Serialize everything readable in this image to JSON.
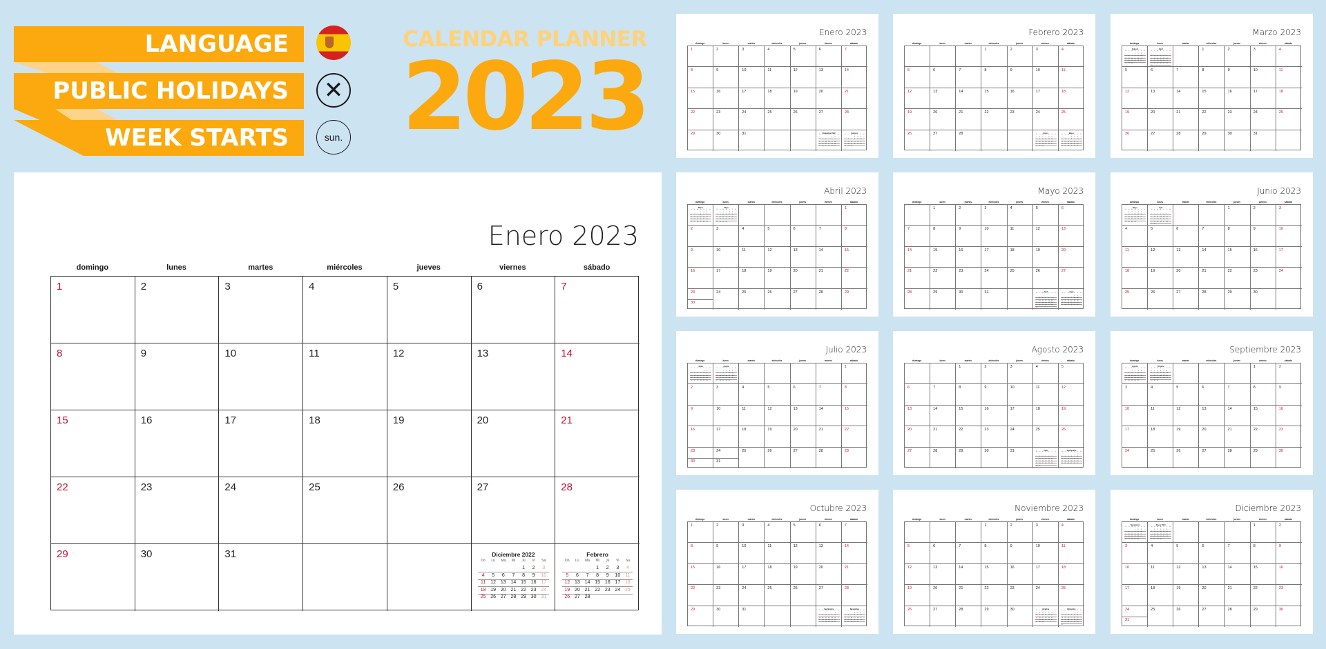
{
  "banner": {
    "language_label": "LANGUAGE",
    "holidays_label": "PUBLIC HOLIDAYS",
    "week_starts_label": "WEEK STARTS",
    "language_icon": "spain-flag-icon",
    "holidays_icon": "x-circle-icon",
    "holidays_symbol": "✕",
    "week_starts_value": "sun."
  },
  "header": {
    "subtitle": "CALENDAR PLANNER",
    "year": "2023"
  },
  "colors": {
    "background": "#cce3f2",
    "accent_orange": "#fba90e",
    "accent_light": "#fdd27a",
    "holiday_red": "#c8102e",
    "card": "#ffffff"
  },
  "weekdays_long": [
    "domingo",
    "lunes",
    "martes",
    "miércoles",
    "jueves",
    "viernes",
    "sábado"
  ],
  "weekdays_short": [
    "Do",
    "Lu",
    "Ma",
    "Mi",
    "Ju",
    "Vi",
    "Sa"
  ],
  "main_calendar": {
    "title": "Enero 2023",
    "month_index": 0
  },
  "months": [
    {
      "name": "Enero",
      "title": "Enero 2023",
      "days": 31,
      "start": 0,
      "mini_pos": "end",
      "mini": [
        {
          "title": "Diciembre 2022",
          "days": 31,
          "start": 4
        },
        {
          "title": "Febrero",
          "days": 28,
          "start": 3
        }
      ]
    },
    {
      "name": "Febrero",
      "title": "Febrero 2023",
      "days": 28,
      "start": 3,
      "mini_pos": "end",
      "mini": [
        {
          "title": "Enero",
          "days": 31,
          "start": 0
        },
        {
          "title": "Marzo",
          "days": 31,
          "start": 3
        }
      ]
    },
    {
      "name": "Marzo",
      "title": "Marzo 2023",
      "days": 31,
      "start": 3,
      "mini_pos": "start",
      "mini": [
        {
          "title": "Febrero",
          "days": 28,
          "start": 3
        },
        {
          "title": "Abril",
          "days": 30,
          "start": 6
        }
      ]
    },
    {
      "name": "Abril",
      "title": "Abril 2023",
      "days": 30,
      "start": 6,
      "mini_pos": "start",
      "mini": [
        {
          "title": "Marzo",
          "days": 31,
          "start": 3
        },
        {
          "title": "Mayo",
          "days": 31,
          "start": 1
        }
      ]
    },
    {
      "name": "Mayo",
      "title": "Mayo 2023",
      "days": 31,
      "start": 1,
      "mini_pos": "end",
      "mini": [
        {
          "title": "Abril",
          "days": 30,
          "start": 6
        },
        {
          "title": "Junio",
          "days": 30,
          "start": 4
        }
      ]
    },
    {
      "name": "Junio",
      "title": "Junio 2023",
      "days": 30,
      "start": 4,
      "mini_pos": "start",
      "mini": [
        {
          "title": "Mayo",
          "days": 31,
          "start": 1
        },
        {
          "title": "Julio",
          "days": 31,
          "start": 6
        }
      ]
    },
    {
      "name": "Julio",
      "title": "Julio 2023",
      "days": 31,
      "start": 6,
      "mini_pos": "start",
      "mini": [
        {
          "title": "Junio",
          "days": 30,
          "start": 4
        },
        {
          "title": "Agosto",
          "days": 31,
          "start": 2
        }
      ]
    },
    {
      "name": "Agosto",
      "title": "Agosto 2023",
      "days": 31,
      "start": 2,
      "mini_pos": "end",
      "mini": [
        {
          "title": "Julio",
          "days": 31,
          "start": 6
        },
        {
          "title": "Septiembre",
          "days": 30,
          "start": 5
        }
      ]
    },
    {
      "name": "Septiembre",
      "title": "Septiembre 2023",
      "days": 30,
      "start": 5,
      "mini_pos": "start",
      "mini": [
        {
          "title": "Agosto",
          "days": 31,
          "start": 2
        },
        {
          "title": "Octubre",
          "days": 31,
          "start": 0
        }
      ]
    },
    {
      "name": "Octubre",
      "title": "Octubre 2023",
      "days": 31,
      "start": 0,
      "mini_pos": "end",
      "mini": [
        {
          "title": "Septiembre",
          "days": 30,
          "start": 5
        },
        {
          "title": "Noviembre",
          "days": 30,
          "start": 3
        }
      ]
    },
    {
      "name": "Noviembre",
      "title": "Noviembre 2023",
      "days": 30,
      "start": 3,
      "mini_pos": "end",
      "mini": [
        {
          "title": "Octubre",
          "days": 31,
          "start": 0
        },
        {
          "title": "Diciembre",
          "days": 31,
          "start": 5
        }
      ]
    },
    {
      "name": "Diciembre",
      "title": "Diciembre 2023",
      "days": 31,
      "start": 5,
      "mini_pos": "start",
      "mini": [
        {
          "title": "Noviembre",
          "days": 30,
          "start": 3
        },
        {
          "title": "Enero 2024",
          "days": 31,
          "start": 1
        }
      ]
    }
  ]
}
